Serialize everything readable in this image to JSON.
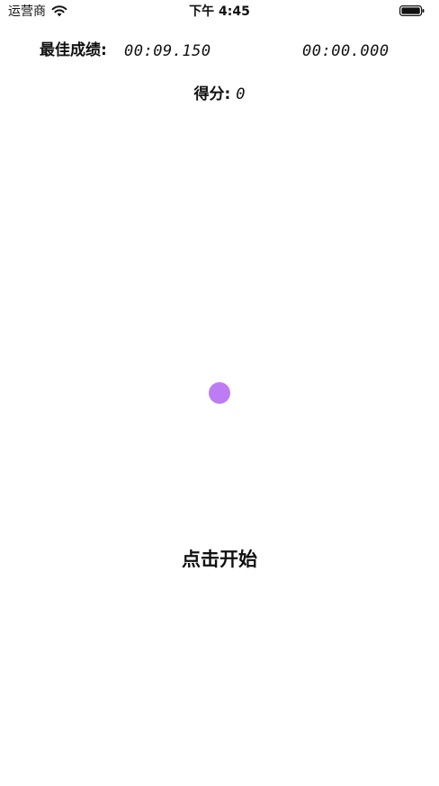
{
  "status_bar": {
    "carrier": "运营商",
    "time": "下午 4:45",
    "wifi_icon": "wifi-icon",
    "battery_icon": "battery-icon"
  },
  "game": {
    "best_label": "最佳成绩:",
    "best_time": "00:09.150",
    "current_time": "00:00.000",
    "score_label": "得分:",
    "score_value": "0",
    "target_color": "#bd7cf4",
    "start_label": "点击开始"
  }
}
